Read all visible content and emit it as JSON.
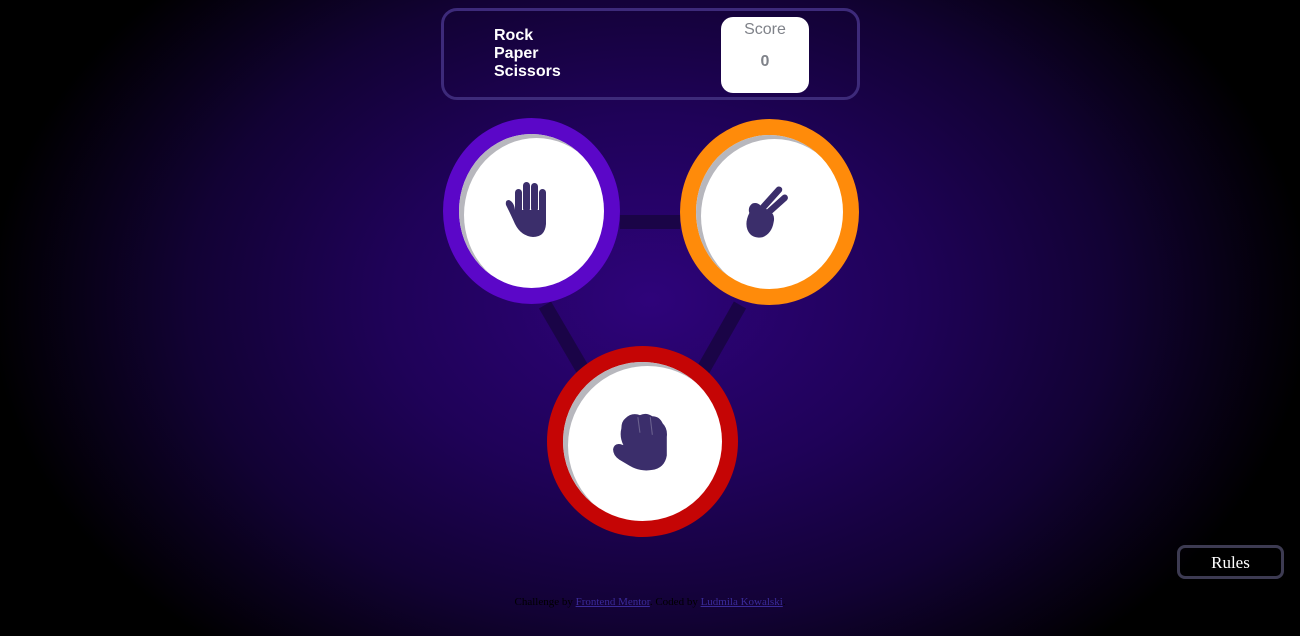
{
  "header": {
    "title_lines": [
      "Rock",
      "Paper",
      "Scissors"
    ],
    "score_label": "Score",
    "score_value": "0"
  },
  "tokens": [
    {
      "name": "paper",
      "icon": "paper-hand-icon",
      "ring_color": "#5b07c8"
    },
    {
      "name": "scissors",
      "icon": "scissors-hand-icon",
      "ring_color": "#ff8b0a"
    },
    {
      "name": "rock",
      "icon": "rock-fist-icon",
      "ring_color": "#c50505"
    }
  ],
  "rules_button": {
    "label": "Rules"
  },
  "attribution": {
    "challenge_text": "Challenge by",
    "challenge_link": "Frontend Mentor",
    "coded_text": ". Coded by",
    "coder_link": "Ludmila Kowalski",
    "suffix": "."
  },
  "colors": {
    "icon_fill": "#3b2e6b",
    "background_center": "#2e037a",
    "connector": "#1a0447"
  }
}
